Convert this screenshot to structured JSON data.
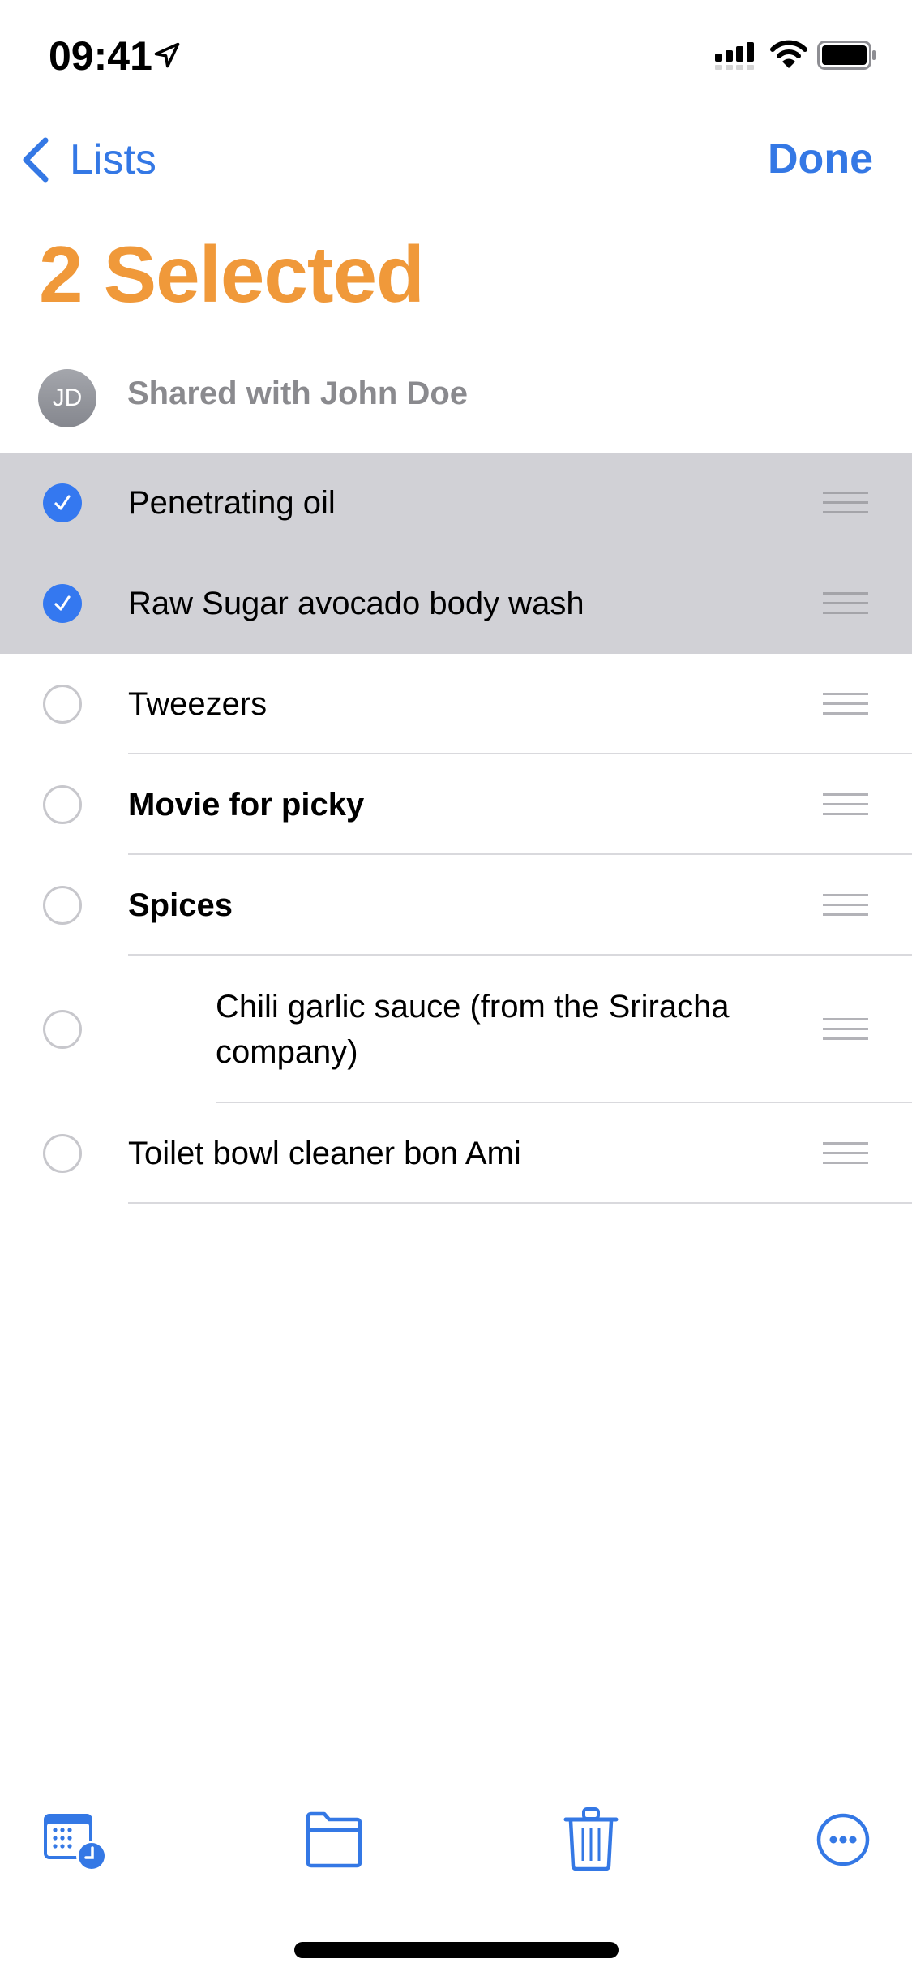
{
  "status_bar": {
    "time": "09:41",
    "icons": [
      "location-arrow-icon",
      "cellular-signal-icon",
      "wifi-icon",
      "battery-icon"
    ]
  },
  "nav": {
    "back_label": "Lists",
    "done_label": "Done"
  },
  "title": "2 Selected",
  "shared": {
    "avatar_initials": "JD",
    "text": "Shared with John Doe"
  },
  "items": [
    {
      "label": "Penetrating oil",
      "selected": true,
      "bold": false,
      "indent": 0
    },
    {
      "label": "Raw Sugar avocado body wash",
      "selected": true,
      "bold": false,
      "indent": 0
    },
    {
      "label": "Tweezers",
      "selected": false,
      "bold": false,
      "indent": 0
    },
    {
      "label": "Movie for picky",
      "selected": false,
      "bold": true,
      "indent": 0
    },
    {
      "label": "Spices",
      "selected": false,
      "bold": true,
      "indent": 0
    },
    {
      "label": "Chili garlic sauce (from the Sriracha company)",
      "selected": false,
      "bold": false,
      "indent": 1
    },
    {
      "label": "Toilet bowl cleaner bon Ami",
      "selected": false,
      "bold": false,
      "indent": 0
    }
  ],
  "toolbar": {
    "items": [
      "calendar-clock-icon",
      "folder-icon",
      "trash-icon",
      "more-icon"
    ]
  },
  "colors": {
    "accent": "#3478e5",
    "title": "#f0993a",
    "selection_background": "#d1d1d6",
    "secondary_text": "#8a8a8e"
  }
}
